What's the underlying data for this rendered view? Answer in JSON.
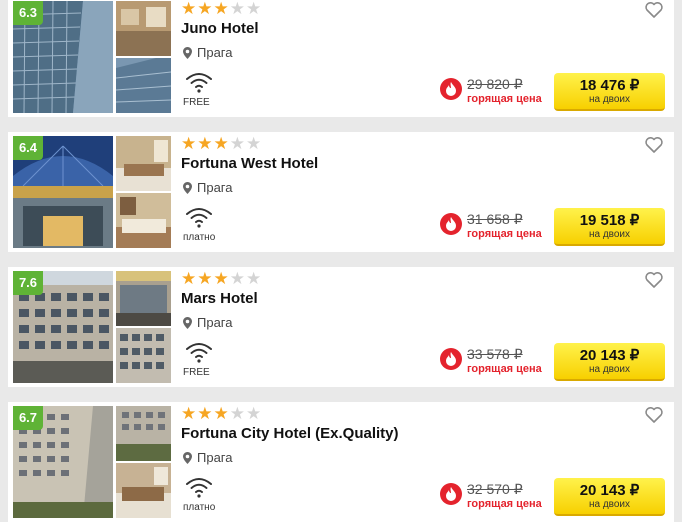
{
  "hotels": [
    {
      "score": "6.3",
      "stars_filled": 3,
      "stars_total": 5,
      "name": "Juno Hotel",
      "city": "Прага",
      "wifi": "FREE",
      "old_price": "29 820 ₽",
      "hot_label": "горящая цена",
      "price": "18 476 ₽",
      "price_note": "на двоих"
    },
    {
      "score": "6.4",
      "stars_filled": 3,
      "stars_total": 5,
      "name": "Fortuna West Hotel",
      "city": "Прага",
      "wifi": "платно",
      "old_price": "31 658 ₽",
      "hot_label": "горящая цена",
      "price": "19 518 ₽",
      "price_note": "на двоих"
    },
    {
      "score": "7.6",
      "stars_filled": 3,
      "stars_total": 5,
      "name": "Mars Hotel",
      "city": "Прага",
      "wifi": "FREE",
      "old_price": "33 578 ₽",
      "hot_label": "горящая цена",
      "price": "20 143 ₽",
      "price_note": "на двоих"
    },
    {
      "score": "6.7",
      "stars_filled": 3,
      "stars_total": 5,
      "name": "Fortuna City Hotel (Ex.Quality)",
      "city": "Прага",
      "wifi": "платно",
      "old_price": "32 570 ₽",
      "hot_label": "горящая цена",
      "price": "20 143 ₽",
      "price_note": "на двоих"
    }
  ],
  "colors": {
    "score_badge": "#5fb336",
    "star_on": "#f6a623",
    "star_off": "#d4d4d4",
    "hot": "#e4232d",
    "button": "#f7d000"
  }
}
